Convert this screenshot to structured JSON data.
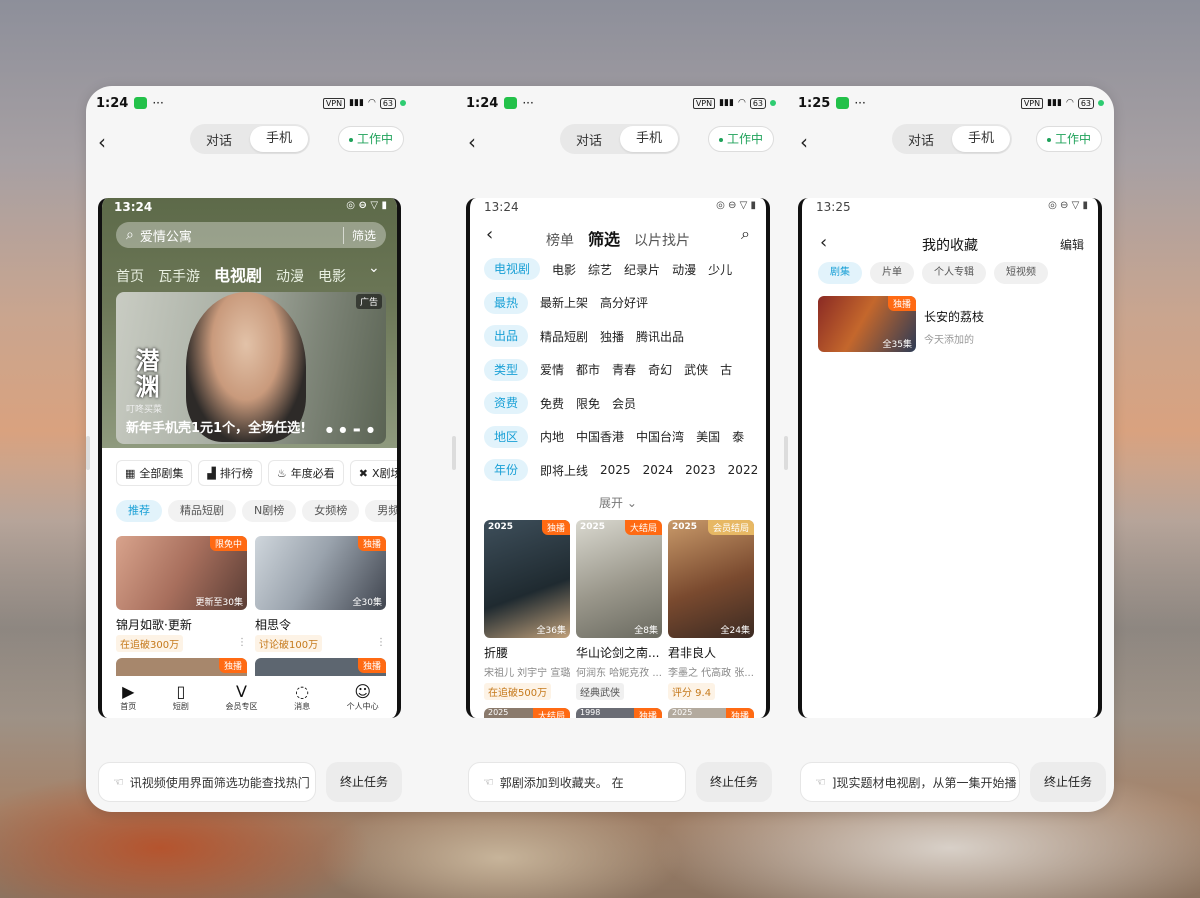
{
  "panels": [
    {
      "status_time": "1:24",
      "segment": {
        "left": "对话",
        "right": "手机"
      },
      "working": "工作中",
      "task_text": "讯视频使用界面筛选功能查找热门",
      "stop_label": "终止任务"
    },
    {
      "status_time": "1:24",
      "segment": {
        "left": "对话",
        "right": "手机"
      },
      "working": "工作中",
      "task_text": "郭剧添加到收藏夹。           在",
      "stop_label": "终止任务"
    },
    {
      "status_time": "1:25",
      "segment": {
        "left": "对话",
        "right": "手机"
      },
      "working": "工作中",
      "task_text": "]现实题材电视剧，从第一集开始播",
      "stop_label": "终止任务"
    }
  ],
  "status_icons": {
    "vpn": "VPN",
    "battery": "63"
  },
  "phone1": {
    "time": "13:24",
    "search_text": "爱情公寓",
    "search_filter": "筛选",
    "nav": [
      "首页",
      "瓦手游",
      "电视剧",
      "动漫",
      "电影"
    ],
    "banner": {
      "logo": "潜渊",
      "sub": "叮咚买菜",
      "caption": "新年手机壳1元1个，全场任选!",
      "ad": "广告"
    },
    "chips": [
      "全部剧集",
      "排行榜",
      "年度必看",
      "X剧场"
    ],
    "tags": [
      "推荐",
      "精品短剧",
      "N剧榜",
      "女频榜",
      "男频榜"
    ],
    "items": [
      {
        "title": "锦月如歌·更新",
        "badge": "限免中",
        "ep": "更新至30集",
        "sub": "在追破300万"
      },
      {
        "title": "相思令",
        "badge": "独播",
        "ep": "全30集",
        "sub": "讨论破100万"
      }
    ],
    "row2_badges": [
      "独播",
      "独播"
    ],
    "tabbar": [
      "首页",
      "短剧",
      "会员专区",
      "消息",
      "个人中心"
    ]
  },
  "phone2": {
    "time": "13:24",
    "tabs": [
      "榜单",
      "筛选",
      "以片找片"
    ],
    "filters": [
      {
        "key": "电视剧",
        "values": [
          "电影",
          "综艺",
          "纪录片",
          "动漫",
          "少儿"
        ]
      },
      {
        "key": "最热",
        "values": [
          "最新上架",
          "高分好评"
        ]
      },
      {
        "key": "出品",
        "values": [
          "精品短剧",
          "独播",
          "腾讯出品"
        ]
      },
      {
        "key": "类型",
        "values": [
          "爱情",
          "都市",
          "青春",
          "奇幻",
          "武侠",
          "古"
        ]
      },
      {
        "key": "资费",
        "values": [
          "免费",
          "限免",
          "会员"
        ]
      },
      {
        "key": "地区",
        "values": [
          "内地",
          "中国香港",
          "中国台湾",
          "美国",
          "泰"
        ]
      },
      {
        "key": "年份",
        "values": [
          "即将上线",
          "2025",
          "2024",
          "2023",
          "2022"
        ]
      }
    ],
    "expand": "展开",
    "items": [
      {
        "year": "2025",
        "badge": "独播",
        "ep": "全36集",
        "title": "折腰",
        "cast": "宋祖儿 刘宇宁 宣璐",
        "sub": "在追破500万"
      },
      {
        "year": "2025",
        "badge": "大结局",
        "ep": "全8集",
        "title": "华山论剑之南...",
        "cast": "何润东 哈妮克孜 ...",
        "sub": "经典武侠"
      },
      {
        "year": "2025",
        "badge": "会员结局",
        "ep": "全24集",
        "title": "君非良人",
        "cast": "李墨之 代高政 张...",
        "sub": "评分 9.4"
      }
    ],
    "row3": [
      {
        "year": "2025",
        "badge": "大结局"
      },
      {
        "year": "1998",
        "badge": "独播"
      },
      {
        "year": "2025",
        "badge": "独播"
      }
    ]
  },
  "phone3": {
    "time": "13:25",
    "title": "我的收藏",
    "edit": "编辑",
    "tags": [
      "剧集",
      "片单",
      "个人专辑",
      "短视频"
    ],
    "fav": {
      "title": "长安的荔枝",
      "sub": "今天添加的",
      "badge": "独播",
      "ep": "全35集"
    }
  },
  "colors": {
    "accent": "#1aa0d6",
    "working": "#1fa25a",
    "badge": "#ff6a13"
  }
}
